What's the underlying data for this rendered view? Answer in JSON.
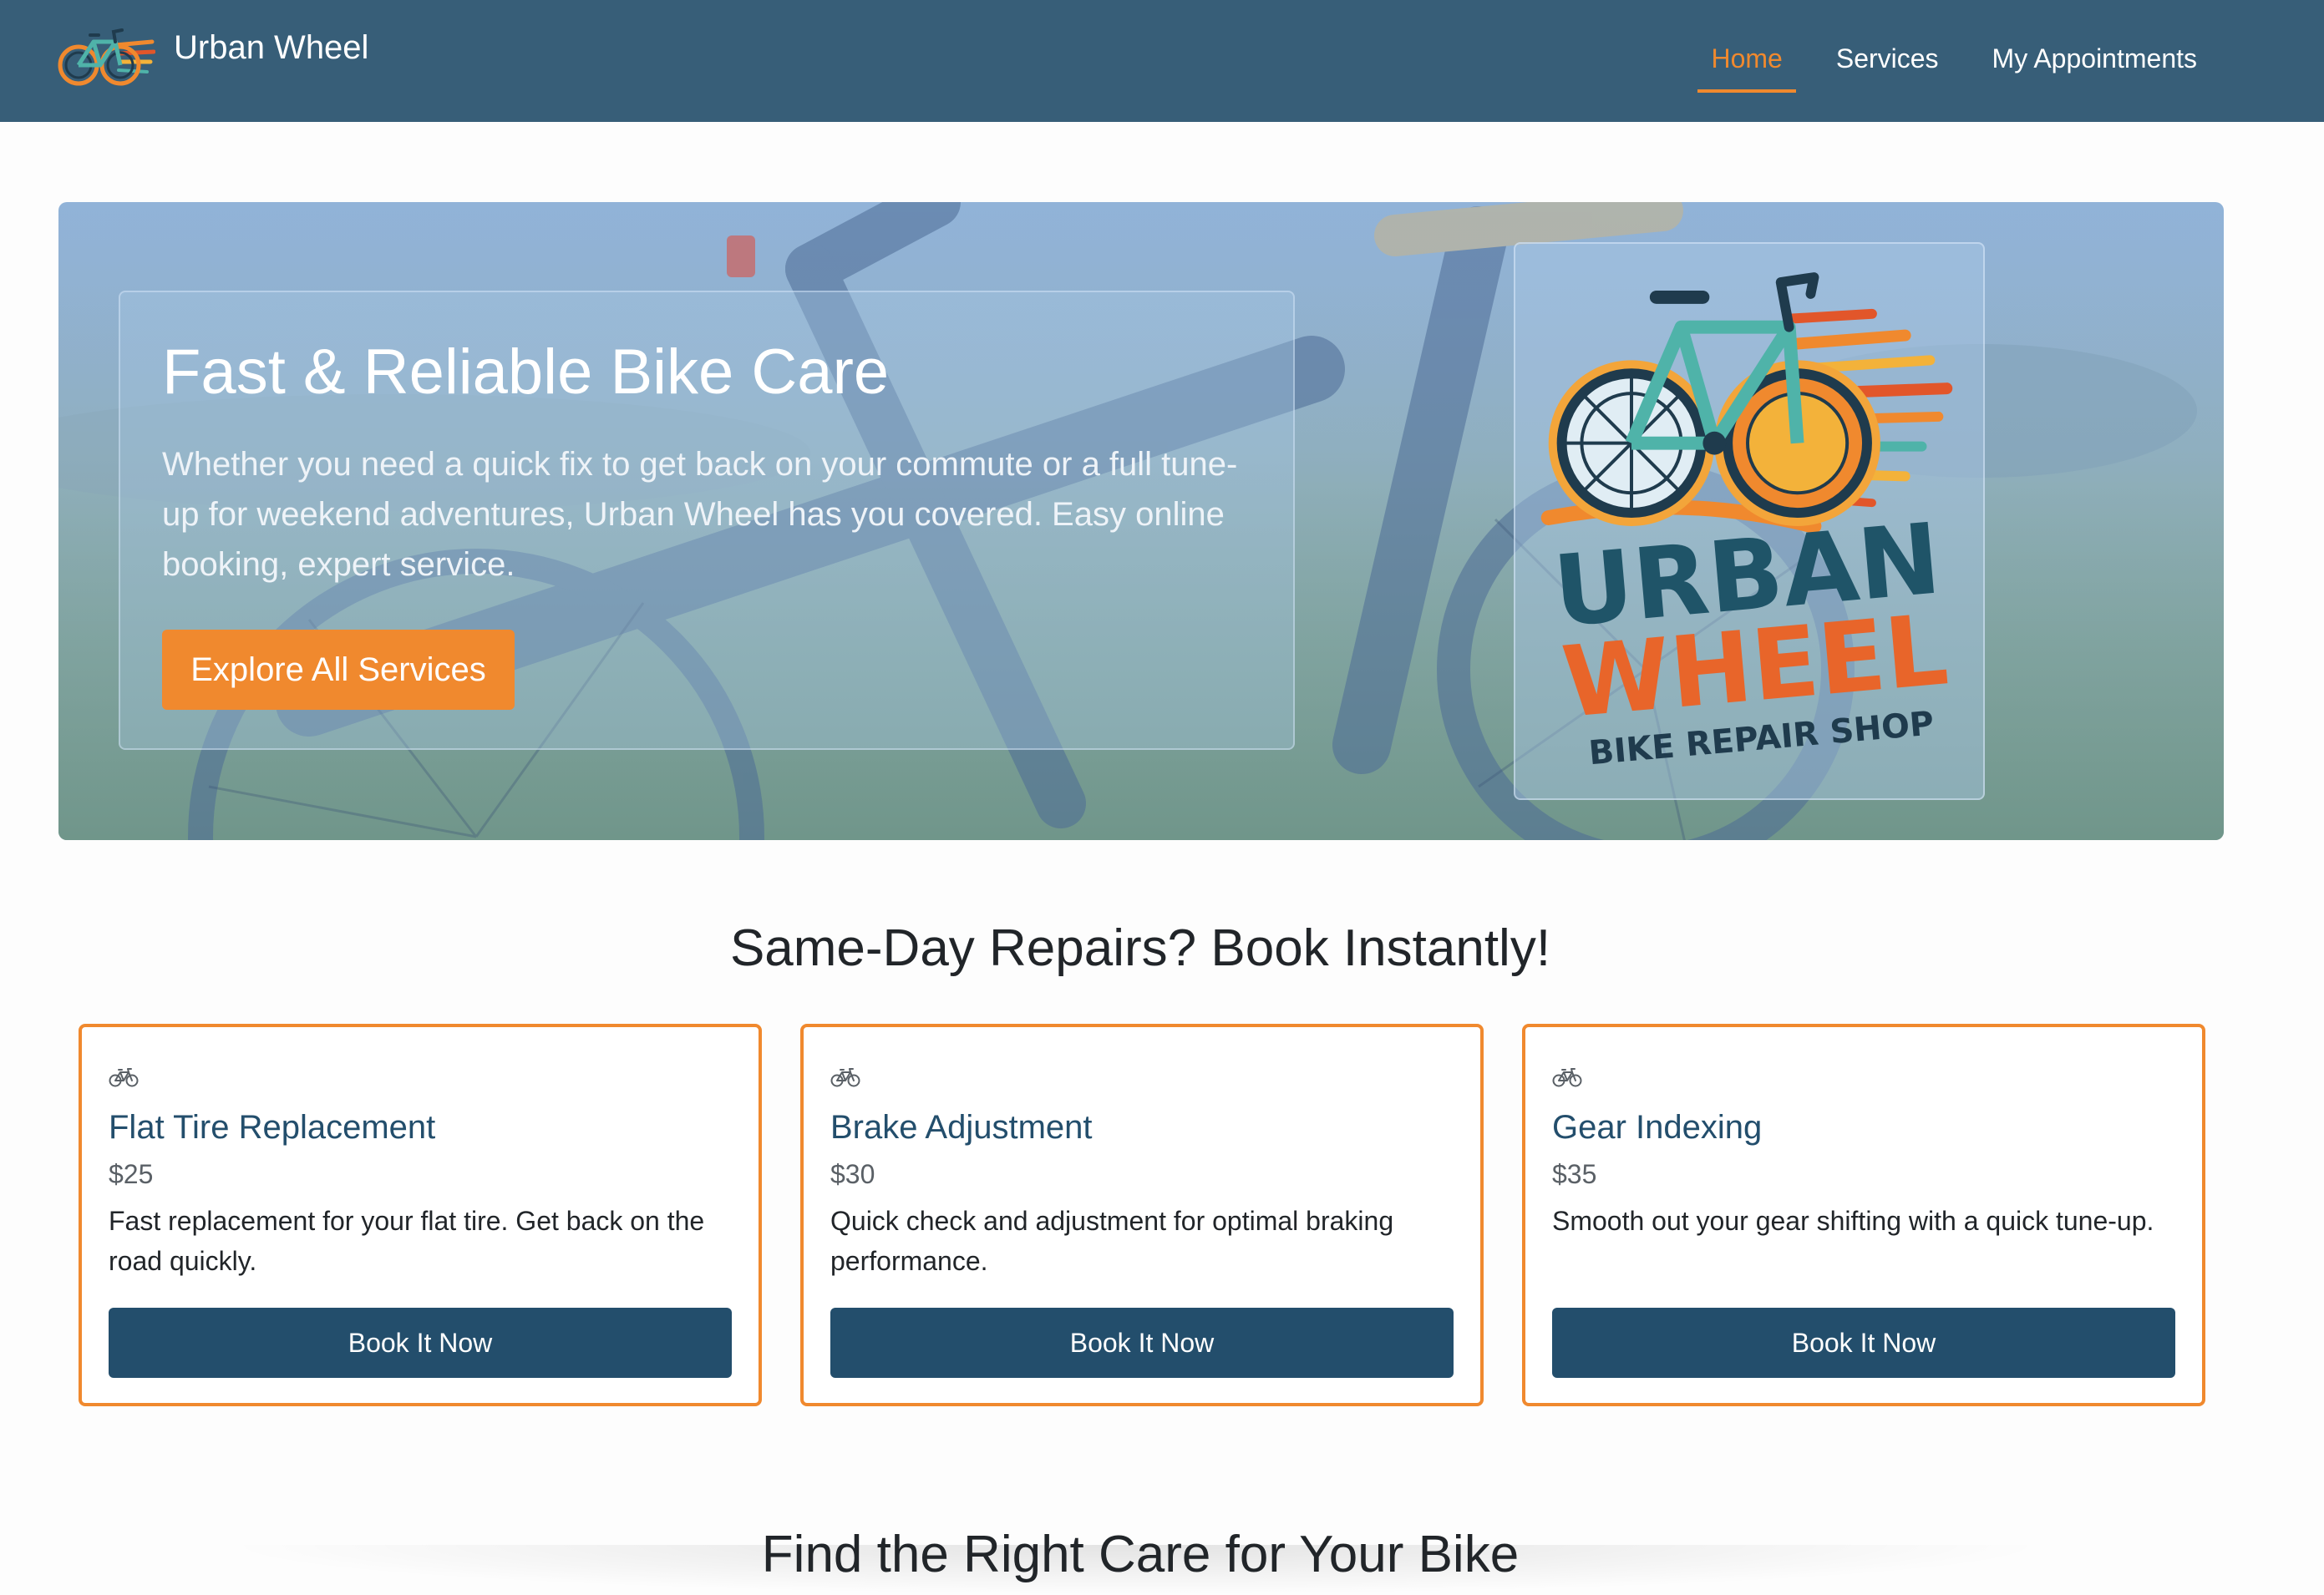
{
  "navbar": {
    "brand_name": "Urban Wheel",
    "links": [
      {
        "label": "Home",
        "active": true
      },
      {
        "label": "Services",
        "active": false
      },
      {
        "label": "My Appointments",
        "active": false
      }
    ]
  },
  "hero": {
    "title": "Fast & Reliable Bike Care",
    "description": "Whether you need a quick fix to get back on your commute or a full tune-up for weekend adventures, Urban Wheel has you covered. Easy online booking, expert service.",
    "button_label": "Explore All Services",
    "logo_text": {
      "line1": "URBAN",
      "line2": "WHEEL",
      "line3": "BIKE REPAIR SHOP"
    }
  },
  "same_day": {
    "title": "Same-Day Repairs? Book Instantly!",
    "cards": [
      {
        "icon": "bicycle-icon",
        "title": "Flat Tire Replacement",
        "price": "$25",
        "description": "Fast replacement for your flat tire. Get back on the road quickly.",
        "button_label": "Book It Now"
      },
      {
        "icon": "bicycle-icon",
        "title": "Brake Adjustment",
        "price": "$30",
        "description": "Quick check and adjustment for optimal braking performance.",
        "button_label": "Book It Now"
      },
      {
        "icon": "bicycle-icon",
        "title": "Gear Indexing",
        "price": "$35",
        "description": "Smooth out your gear shifting with a quick tune-up.",
        "button_label": "Book It Now"
      }
    ]
  },
  "find_care": {
    "title": "Find the Right Care for Your Bike"
  },
  "colors": {
    "navbar": "#375e78",
    "accent": "#f0892e",
    "primary_button": "#234e6c",
    "card_title": "#234e6c"
  }
}
